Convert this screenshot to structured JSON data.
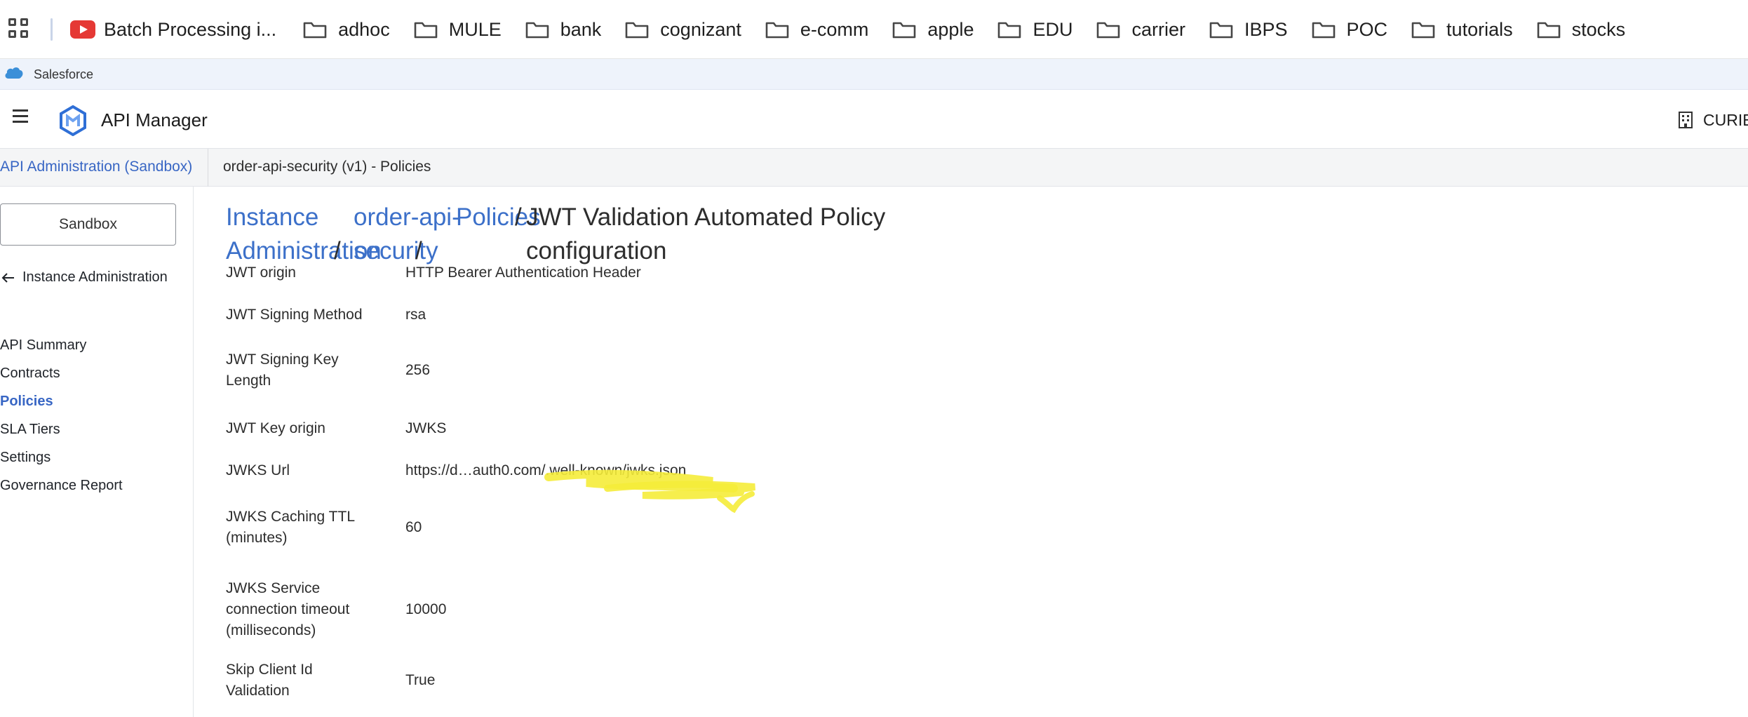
{
  "bookmarks": {
    "items": [
      {
        "label": "Batch Processing i...",
        "icon": "youtube-icon"
      },
      {
        "label": "adhoc",
        "icon": "folder-icon"
      },
      {
        "label": "MULE",
        "icon": "folder-icon"
      },
      {
        "label": "bank",
        "icon": "folder-icon"
      },
      {
        "label": "cognizant",
        "icon": "folder-icon"
      },
      {
        "label": "e-comm",
        "icon": "folder-icon"
      },
      {
        "label": "apple",
        "icon": "folder-icon"
      },
      {
        "label": "EDU",
        "icon": "folder-icon"
      },
      {
        "label": "carrier",
        "icon": "folder-icon"
      },
      {
        "label": "IBPS",
        "icon": "folder-icon"
      },
      {
        "label": "POC",
        "icon": "folder-icon"
      },
      {
        "label": "tutorials",
        "icon": "folder-icon"
      },
      {
        "label": "stocks",
        "icon": "folder-icon"
      }
    ]
  },
  "salesforce_strip": {
    "label": "Salesforce"
  },
  "header": {
    "title": "API Manager",
    "org": "CURIE"
  },
  "breadcrumb": {
    "environment_link": "API Administration (Sandbox)",
    "current": "order-api-security (v1) - Policies"
  },
  "sidebar": {
    "environment_button": "Sandbox",
    "back_link": "Instance Administration",
    "items": [
      {
        "label": "API Summary",
        "active": false
      },
      {
        "label": "Contracts",
        "active": false
      },
      {
        "label": "Policies",
        "active": true
      },
      {
        "label": "SLA Tiers",
        "active": false
      },
      {
        "label": "Settings",
        "active": false
      },
      {
        "label": "Governance Report",
        "active": false
      }
    ]
  },
  "heading": {
    "crumb1_line1": "Instance",
    "crumb1_line2": "Administration",
    "crumb2_line1": "order-api-",
    "crumb2_line2": "security",
    "crumb3": "Policies",
    "separator": "/",
    "title_line1": "JWT Validation Automated Policy",
    "title_line2": "configuration"
  },
  "details": [
    {
      "label_lines": [
        "JWT origin"
      ],
      "value": "HTTP Bearer Authentication Header"
    },
    {
      "label_lines": [
        "JWT Signing Method"
      ],
      "value": "rsa"
    },
    {
      "label_lines": [
        "JWT Signing Key",
        "Length"
      ],
      "value": "256"
    },
    {
      "label_lines": [
        "JWT Key origin"
      ],
      "value": "JWKS"
    },
    {
      "label_lines": [
        "JWKS Url"
      ],
      "value": "https://d…auth0.com/.well-known/jwks.json"
    },
    {
      "label_lines": [
        "JWKS Caching TTL",
        "(minutes)"
      ],
      "value": "60"
    },
    {
      "label_lines": [
        "JWKS Service",
        "connection timeout",
        "(milliseconds)"
      ],
      "value": "10000"
    },
    {
      "label_lines": [
        "Skip Client Id",
        "Validation"
      ],
      "value": "True"
    }
  ],
  "colors": {
    "link": "#3866c4",
    "highlighter": "#f5ec3a"
  }
}
